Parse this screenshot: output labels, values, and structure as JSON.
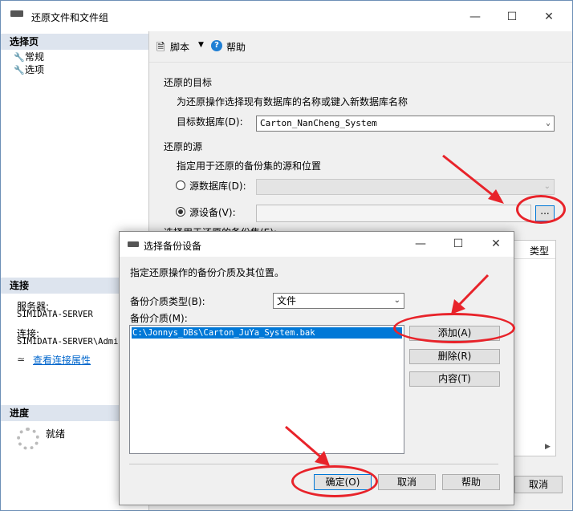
{
  "main_window": {
    "title": "还原文件和文件组",
    "left_pane": {
      "select_page_header": "选择页",
      "pages": [
        {
          "label": "常规",
          "icon": "wrench-icon"
        },
        {
          "label": "选项",
          "icon": "wrench-icon"
        }
      ],
      "connection_header": "连接",
      "server_label": "服务器:",
      "server_value": "SIMIDATA-SERVER",
      "connection_label": "连接:",
      "connection_value": "SIMIDATA-SERVER\\Admin",
      "view_properties_link": "查看连接属性",
      "progress_header": "进度",
      "progress_status": "就绪"
    },
    "toolbar": {
      "script_label": "脚本",
      "help_label": "帮助"
    },
    "restore_target": {
      "section_title": "还原的目标",
      "description": "为还原操作选择现有数据库的名称或键入新数据库名称",
      "target_db_label": "目标数据库(D):",
      "target_db_value": "Carton_NanCheng_System"
    },
    "restore_source": {
      "section_title": "还原的源",
      "description": "指定用于还原的备份集的源和位置",
      "source_db_label": "源数据库(D):",
      "source_device_label": "源设备(V):",
      "browse_label": "...",
      "backup_sets_label": "选择用于还原的备份集(E):",
      "column_type": "类型"
    },
    "cancel_label": "取消"
  },
  "dialog": {
    "title": "选择备份设备",
    "description": "指定还原操作的备份介质及其位置。",
    "media_type_label": "备份介质类型(B):",
    "media_type_value": "文件",
    "media_label": "备份介质(M):",
    "media_items": [
      "C:\\Jonnys_DBs\\Carton_JuYa_System.bak"
    ],
    "add_label": "添加(A)",
    "remove_label": "删除(R)",
    "contents_label": "内容(T)",
    "ok_label": "确定(O)",
    "cancel_label": "取消",
    "help_label": "帮助"
  },
  "colors": {
    "annotation_red": "#e8232a",
    "selection_blue": "#0078d7",
    "link_blue": "#0066cc"
  }
}
